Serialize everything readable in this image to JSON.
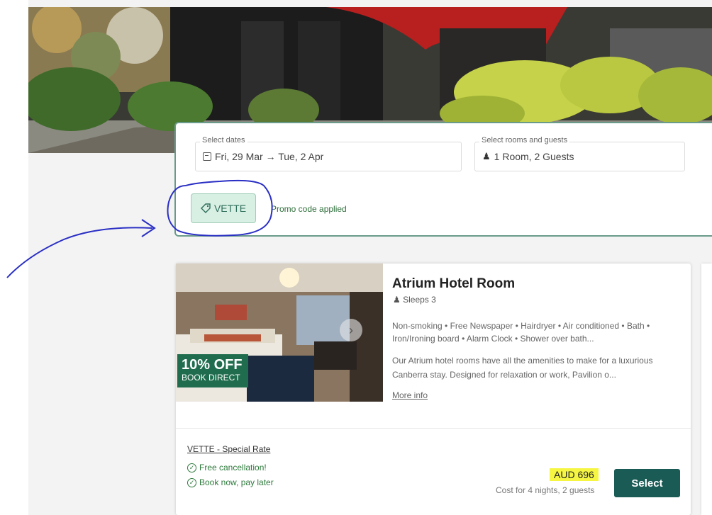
{
  "search": {
    "dates_label": "Select dates",
    "dates_value": "Fri, 29 Mar → Tue, 2 Apr",
    "rooms_label": "Select rooms and guests",
    "rooms_value": "1 Room, 2 Guests"
  },
  "promo": {
    "code": "VETTE",
    "status": "Promo code applied"
  },
  "room": {
    "title": "Atrium Hotel Room",
    "sleeps": "Sleeps 3",
    "amenities": "Non-smoking • Free Newspaper • Hairdryer • Air conditioned • Bath • Iron/Ironing board • Alarm Clock • Shower over bath...",
    "description": "Our Atrium hotel rooms have all the amenities to make for a luxurious Canberra stay. Designed for relaxation or work, Pavilion o...",
    "more_info": "More info",
    "badge_main": "10% OFF",
    "badge_sub": "BOOK DIRECT",
    "rate_name": "VETTE - Special Rate",
    "perks": [
      "Free cancellation!",
      "Book now, pay later"
    ],
    "price": "AUD 696",
    "price_note": "Cost for 4 nights, 2 guests",
    "select_label": "Select"
  },
  "icons": {
    "calendar": "calendar-icon",
    "person": "person-icon",
    "tag": "tag-icon",
    "check": "check-circle-icon",
    "chevron": "chevron-right-icon"
  },
  "colors": {
    "accent": "#1a5b55",
    "promo_chip_bg": "#d8efe4",
    "badge": "#1f6d4e",
    "price_highlight": "#f5f542",
    "annotation_ink": "#2a2fc4"
  }
}
